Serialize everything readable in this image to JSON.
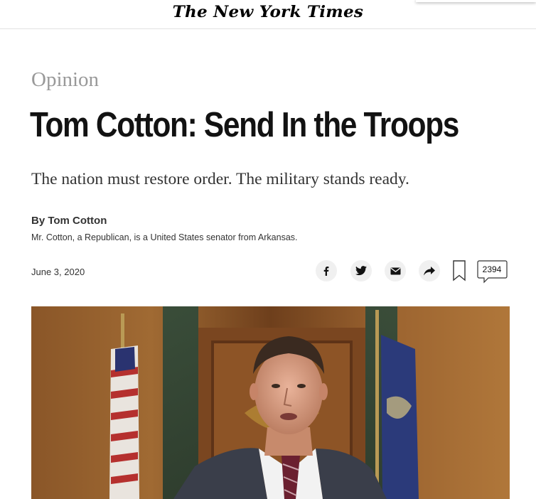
{
  "masthead": {
    "logo": "The New York Times"
  },
  "article": {
    "kicker": "Opinion",
    "headline": "Tom Cotton: Send In the Troops",
    "dek": "The nation must restore order. The military stands ready.",
    "byline": "By Tom Cotton",
    "author_bio": "Mr. Cotton, a Republican, is a United States senator from Arkansas.",
    "date": "June 3, 2020"
  },
  "toolbar": {
    "share_buttons": [
      {
        "icon": "facebook-icon"
      },
      {
        "icon": "twitter-icon"
      },
      {
        "icon": "email-icon"
      },
      {
        "icon": "share-icon"
      }
    ],
    "bookmark_icon": "bookmark-icon",
    "comment_count": "2394"
  },
  "colors": {
    "kicker": "#999999",
    "headline": "#121212",
    "button_bg": "#f0f0f0"
  }
}
